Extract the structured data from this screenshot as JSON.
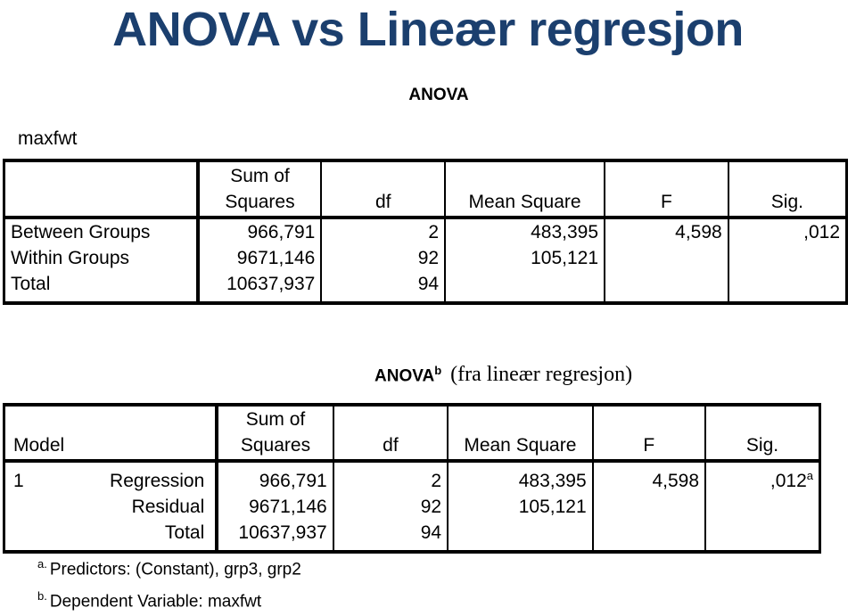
{
  "slide": {
    "title": "ANOVA vs Lineær regresjon"
  },
  "table_one": {
    "caption": "ANOVA",
    "corner_label": "maxfwt",
    "headers": {
      "col0": "",
      "col1_line1": "Sum of",
      "col1_line2": "Squares",
      "col2": "df",
      "col3": "Mean Square",
      "col4": "F",
      "col5": "Sig."
    },
    "rows": [
      {
        "label": "Between Groups",
        "sum_of_squares": "966,791",
        "df": "2",
        "mean_square": "483,395",
        "f": "4,598",
        "sig": ",012"
      },
      {
        "label": "Within Groups",
        "sum_of_squares": "9671,146",
        "df": "92",
        "mean_square": "105,121",
        "f": "",
        "sig": ""
      },
      {
        "label": "Total",
        "sum_of_squares": "10637,937",
        "df": "94",
        "mean_square": "",
        "f": "",
        "sig": ""
      }
    ]
  },
  "table_two": {
    "caption_main": "ANOVA",
    "caption_sup": "b",
    "caption_note": "(fra lineær regresjon)",
    "headers": {
      "model": "Model",
      "model_sub": "",
      "col1_line1": "Sum of",
      "col1_line2": "Squares",
      "col2": "df",
      "col3": "Mean Square",
      "col4": "F",
      "col5": "Sig."
    },
    "rows": [
      {
        "model": "1",
        "label": "Regression",
        "sum_of_squares": "966,791",
        "df": "2",
        "mean_square": "483,395",
        "f": "4,598",
        "sig": ",012",
        "sig_sup": "a"
      },
      {
        "model": "",
        "label": "Residual",
        "sum_of_squares": "9671,146",
        "df": "92",
        "mean_square": "105,121",
        "f": "",
        "sig": "",
        "sig_sup": ""
      },
      {
        "model": "",
        "label": "Total",
        "sum_of_squares": "10637,937",
        "df": "94",
        "mean_square": "",
        "f": "",
        "sig": "",
        "sig_sup": ""
      }
    ],
    "footnotes": [
      {
        "marker": "a.",
        "text": "Predictors: (Constant), grp3, grp2"
      },
      {
        "marker": "b.",
        "text": "Dependent Variable: maxfwt"
      }
    ]
  },
  "colors": {
    "title": "#1b3f6e",
    "text": "#000000",
    "background": "#ffffff",
    "rule": "#000000"
  }
}
